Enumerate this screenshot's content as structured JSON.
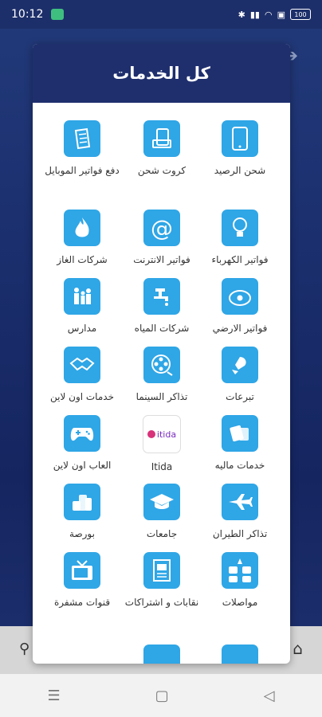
{
  "status_bar": {
    "time": "10:12",
    "battery": "100"
  },
  "dialog": {
    "title": "كل الخدمات"
  },
  "services": [
    {
      "label": "شحن الرصيد",
      "icon": "phone-icon"
    },
    {
      "label": "كروت شحن",
      "icon": "cards-icon"
    },
    {
      "label": "دفع فواتير الموبايل",
      "icon": "bill-icon"
    },
    {
      "label": "فواتير الكهرباء",
      "icon": "bulb-icon"
    },
    {
      "label": "فواتير الانترنت",
      "icon": "at-icon"
    },
    {
      "label": "شركات الغاز",
      "icon": "flame-icon"
    },
    {
      "label": "فواتير الارضي",
      "icon": "telephone-icon"
    },
    {
      "label": "شركات المياه",
      "icon": "tap-icon"
    },
    {
      "label": "مدارس",
      "icon": "family-icon"
    },
    {
      "label": "تبرعات",
      "icon": "donation-icon"
    },
    {
      "label": "تذاكر السينما",
      "icon": "film-reel-icon"
    },
    {
      "label": "خدمات اون لاين",
      "icon": "handshake-icon"
    },
    {
      "label": "خدمات ماليه",
      "icon": "money-icon"
    },
    {
      "label": "Itida",
      "icon": "itida-logo",
      "logo_text": "itida"
    },
    {
      "label": "العاب اون لاين",
      "icon": "gamepad-icon"
    },
    {
      "label": "تذاكر الطيران",
      "icon": "airplane-icon"
    },
    {
      "label": "جامعات",
      "icon": "graduation-cap-icon"
    },
    {
      "label": "بورصة",
      "icon": "coins-icon"
    },
    {
      "label": "مواصلات",
      "icon": "transport-icon"
    },
    {
      "label": "نقابات و اشتراكات",
      "icon": "membership-icon"
    },
    {
      "label": "قنوات مشفرة",
      "icon": "tv-icon"
    }
  ],
  "colors": {
    "header": "#1f2f6e",
    "tile_icon": "#2fa6e6"
  }
}
